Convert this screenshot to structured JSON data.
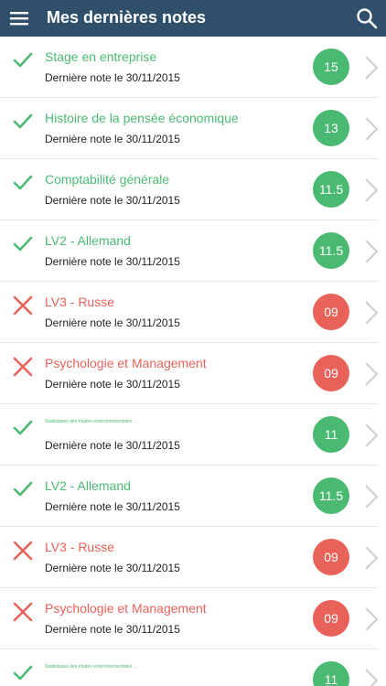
{
  "header": {
    "title": "Mes dernières notes",
    "menu_icon": "hamburger-menu-icon",
    "search_icon": "search-icon"
  },
  "colors": {
    "header_bg": "#2f4f6b",
    "pass": "#4aba73",
    "fail": "#e9625a",
    "chevron": "#cfcfcf"
  },
  "notes": [
    {
      "course": "Stage en entreprise",
      "subtitle": "Dernière note le 30/11/2015",
      "grade": "15",
      "status": "pass"
    },
    {
      "course": "Histoire de la pensée économique",
      "subtitle": "Dernière note le 30/11/2015",
      "grade": "13",
      "status": "pass"
    },
    {
      "course": "Comptabilité générale",
      "subtitle": "Dernière note le 30/11/2015",
      "grade": "11.5",
      "status": "pass"
    },
    {
      "course": "LV2 - Allemand",
      "subtitle": "Dernière note le 30/11/2015",
      "grade": "11.5",
      "status": "pass"
    },
    {
      "course": "LV3 - Russe",
      "subtitle": "Dernière note le 30/11/2015",
      "grade": "09",
      "status": "fail"
    },
    {
      "course": "Psychologie et Management",
      "subtitle": "Dernière note le 30/11/2015",
      "grade": "09",
      "status": "fail"
    },
    {
      "course": "Statistiques des études environnementales ...",
      "subtitle": "Dernière note le 30/11/2015",
      "grade": "11",
      "status": "pass",
      "small": true
    },
    {
      "course": "LV2 - Allemand",
      "subtitle": "Dernière note le 30/11/2015",
      "grade": "11.5",
      "status": "pass"
    },
    {
      "course": "LV3 - Russe",
      "subtitle": "Dernière note le 30/11/2015",
      "grade": "09",
      "status": "fail"
    },
    {
      "course": "Psychologie et Management",
      "subtitle": "Dernière note le 30/11/2015",
      "grade": "09",
      "status": "fail"
    },
    {
      "course": "Statistiques des études environnementales ...",
      "subtitle": "",
      "grade": "11",
      "status": "pass",
      "small": true
    }
  ]
}
